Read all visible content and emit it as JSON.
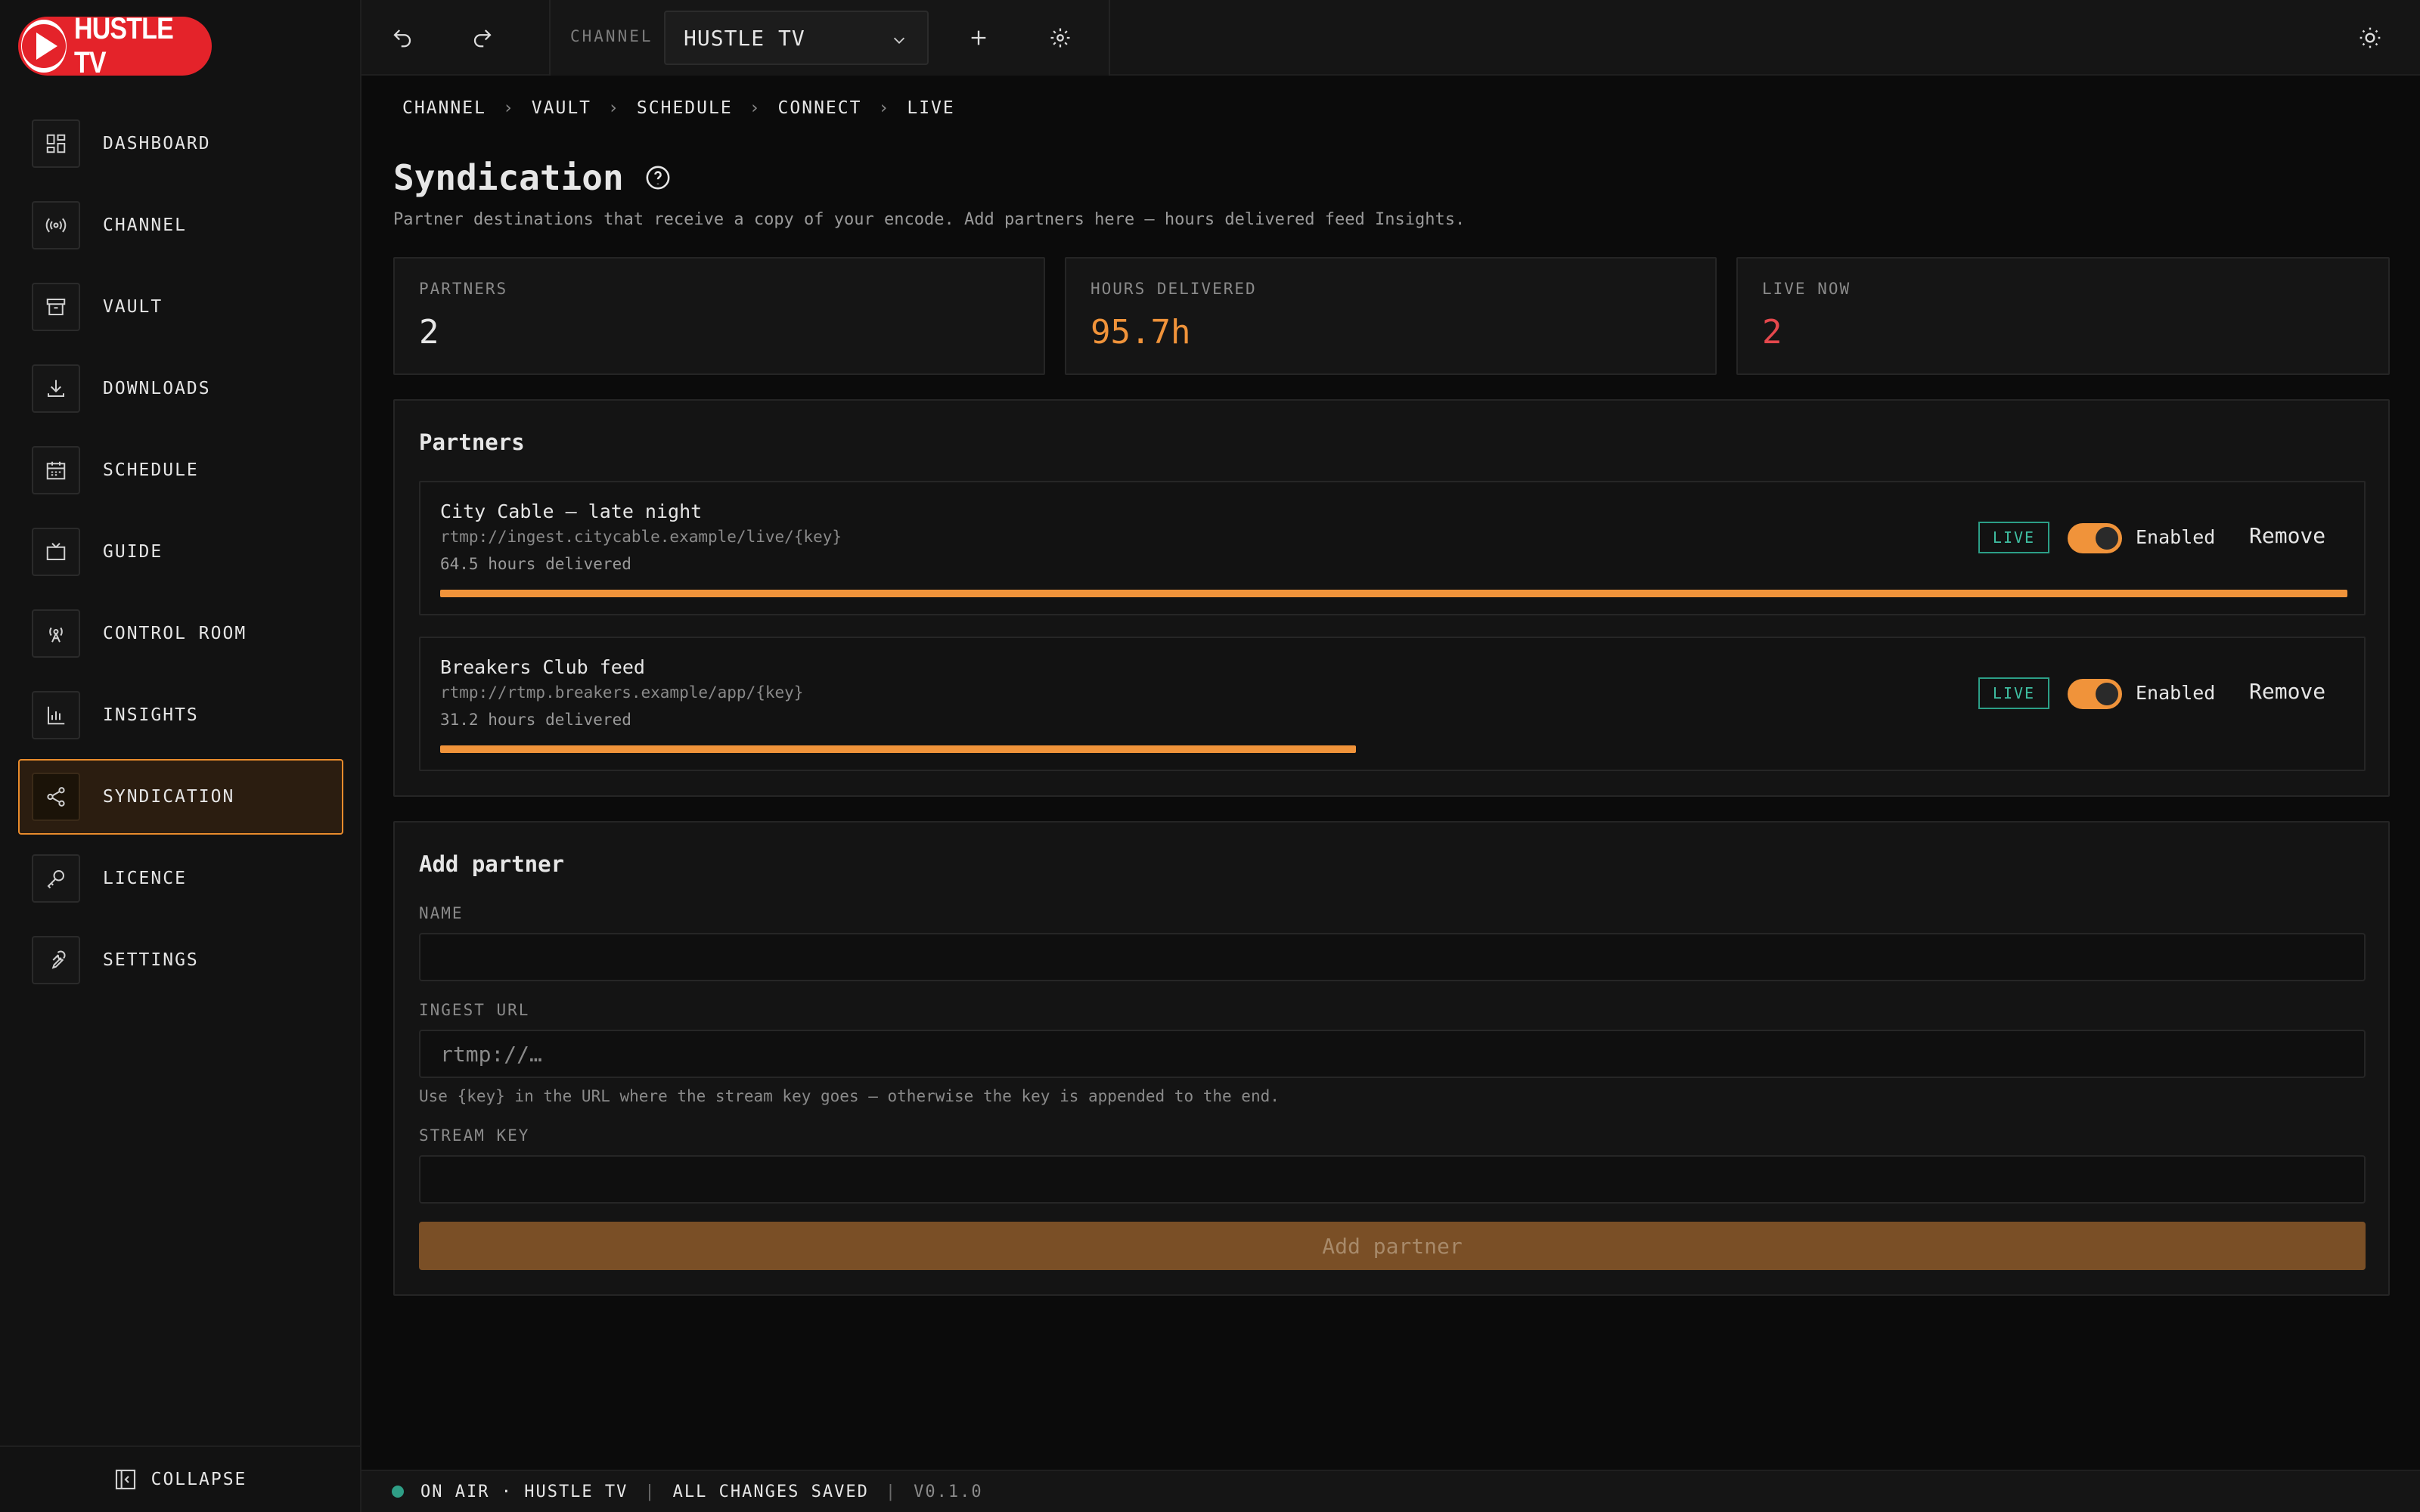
{
  "app": {
    "logo_text": "HUSTLE TV"
  },
  "sidebar": {
    "items": [
      {
        "label": "DASHBOARD",
        "icon": "dashboard-icon"
      },
      {
        "label": "CHANNEL",
        "icon": "broadcast-icon"
      },
      {
        "label": "VAULT",
        "icon": "archive-icon"
      },
      {
        "label": "DOWNLOADS",
        "icon": "download-icon"
      },
      {
        "label": "SCHEDULE",
        "icon": "calendar-icon"
      },
      {
        "label": "GUIDE",
        "icon": "tv-icon"
      },
      {
        "label": "CONTROL ROOM",
        "icon": "antenna-icon"
      },
      {
        "label": "INSIGHTS",
        "icon": "bar-chart-icon"
      },
      {
        "label": "SYNDICATION",
        "icon": "share-icon",
        "active": true
      },
      {
        "label": "LICENCE",
        "icon": "key-icon"
      },
      {
        "label": "SETTINGS",
        "icon": "wrench-icon"
      }
    ],
    "collapse_label": "COLLAPSE"
  },
  "topbar": {
    "channel_label": "CHANNEL",
    "channel_value": "HUSTLE TV"
  },
  "breadcrumb": [
    "CHANNEL",
    "VAULT",
    "SCHEDULE",
    "CONNECT",
    "LIVE"
  ],
  "page": {
    "title": "Syndication",
    "subtitle": "Partner destinations that receive a copy of your encode. Add partners here — hours delivered feed Insights."
  },
  "stats": [
    {
      "label": "PARTNERS",
      "value": "2",
      "color": "#e6e6e6"
    },
    {
      "label": "HOURS DELIVERED",
      "value": "95.7h",
      "color": "#f0933a"
    },
    {
      "label": "LIVE NOW",
      "value": "2",
      "color": "#e5484d"
    }
  ],
  "partners_panel": {
    "title": "Partners",
    "partners": [
      {
        "name": "City Cable — late night",
        "url": "rtmp://ingest.citycable.example/live/{key}",
        "hours": "64.5 hours delivered",
        "progress": 1.0,
        "badge": "LIVE",
        "toggle_label": "Enabled",
        "remove_label": "Remove"
      },
      {
        "name": "Breakers Club feed",
        "url": "rtmp://rtmp.breakers.example/app/{key}",
        "hours": "31.2 hours delivered",
        "progress": 0.48,
        "badge": "LIVE",
        "toggle_label": "Enabled",
        "remove_label": "Remove"
      }
    ]
  },
  "add_partner": {
    "title": "Add partner",
    "name_label": "NAME",
    "name_value": "",
    "url_label": "INGEST URL",
    "url_placeholder": "rtmp://…",
    "url_hint": "Use {key} in the URL where the stream key goes — otherwise the key is appended to the end.",
    "key_label": "STREAM KEY",
    "key_value": "",
    "button_label": "Add partner"
  },
  "statusbar": {
    "on_air": "ON AIR · HUSTLE TV",
    "saved": "ALL CHANGES SAVED",
    "version": "V0.1.0"
  }
}
